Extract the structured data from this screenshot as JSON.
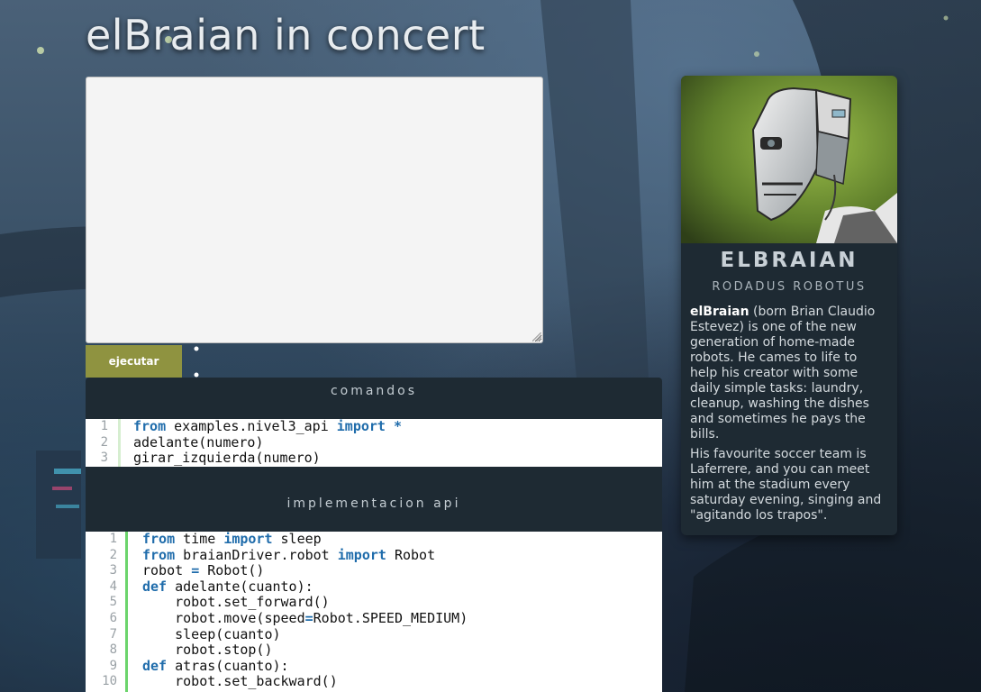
{
  "page": {
    "title": "elBraian in concert"
  },
  "editor": {
    "value": "",
    "run_label": "ejecutar"
  },
  "comandos": {
    "header": "comandos",
    "lines": [
      {
        "n": "1",
        "tokens": [
          {
            "t": "from",
            "k": "kw"
          },
          {
            "t": " examples.nivel3_api "
          },
          {
            "t": "import",
            "k": "kw"
          },
          {
            "t": " "
          },
          {
            "t": "*",
            "k": "op"
          }
        ]
      },
      {
        "n": "2",
        "tokens": [
          {
            "t": "adelante(numero)"
          }
        ]
      },
      {
        "n": "3",
        "tokens": [
          {
            "t": "girar_izquierda(numero)"
          }
        ]
      }
    ]
  },
  "api": {
    "header": "implementacion api",
    "lines": [
      {
        "n": "1",
        "tokens": [
          {
            "t": "from",
            "k": "kw"
          },
          {
            "t": " time "
          },
          {
            "t": "import",
            "k": "kw"
          },
          {
            "t": " sleep"
          }
        ]
      },
      {
        "n": "2",
        "tokens": [
          {
            "t": "from",
            "k": "kw"
          },
          {
            "t": " braianDriver.robot "
          },
          {
            "t": "import",
            "k": "kw"
          },
          {
            "t": " Robot"
          }
        ]
      },
      {
        "n": "3",
        "tokens": [
          {
            "t": "robot "
          },
          {
            "t": "=",
            "k": "op"
          },
          {
            "t": " Robot()"
          }
        ]
      },
      {
        "n": "4",
        "tokens": [
          {
            "t": "def",
            "k": "kw"
          },
          {
            "t": " adelante(cuanto):"
          }
        ]
      },
      {
        "n": "5",
        "tokens": [
          {
            "t": "    robot.set_forward()"
          }
        ]
      },
      {
        "n": "6",
        "tokens": [
          {
            "t": "    robot.move(speed"
          },
          {
            "t": "=",
            "k": "op"
          },
          {
            "t": "Robot.SPEED_MEDIUM)"
          }
        ]
      },
      {
        "n": "7",
        "tokens": [
          {
            "t": "    sleep(cuanto)"
          }
        ]
      },
      {
        "n": "8",
        "tokens": [
          {
            "t": "    robot.stop()"
          }
        ]
      },
      {
        "n": "9",
        "tokens": [
          {
            "t": "def",
            "k": "kw"
          },
          {
            "t": " atras(cuanto):"
          }
        ]
      },
      {
        "n": "10",
        "tokens": [
          {
            "t": "    robot.set_backward()"
          }
        ]
      }
    ]
  },
  "profile": {
    "name": "ELBRAIAN",
    "subtitle": "RODADUS ROBOTUS",
    "bio_name": "elBraian",
    "bio_p1": " (born Brian Claudio Estevez) is one of the new generation of home-made robots. He cames to life to help his creator with some daily simple tasks: laundry, cleanup, washing the dishes and sometimes he pays the bills.",
    "bio_p2": "His favourite soccer team is Laferrere, and you can meet him at the stadium every saturday evening, singing and \"agitando los trapos\"."
  },
  "colors": {
    "run_button": "#8f9340",
    "panel": "#1e2a33",
    "keyword": "#1f6cab",
    "gutter_accent": "#6cd46c"
  },
  "icons": {
    "robot_portrait": "robot-head-illustration"
  }
}
